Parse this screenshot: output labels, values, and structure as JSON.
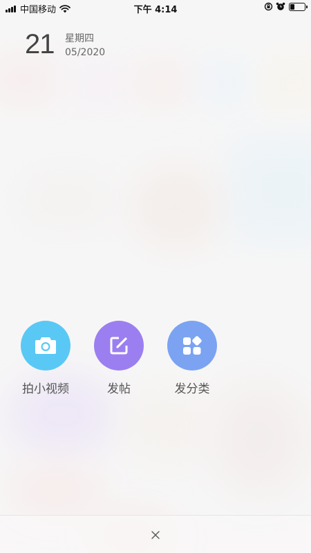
{
  "status_bar": {
    "carrier": "中国移动",
    "time": "下午 4:14"
  },
  "date": {
    "day": "21",
    "weekday": "星期四",
    "month_year": "05/2020"
  },
  "actions": [
    {
      "label": "拍小视频",
      "icon": "camera-icon",
      "color": "#5ac8f5"
    },
    {
      "label": "发帖",
      "icon": "edit-icon",
      "color": "#9b7ff0"
    },
    {
      "label": "发分类",
      "icon": "category-icon",
      "color": "#7ba3f2"
    }
  ],
  "close": {
    "icon": "close-icon"
  }
}
